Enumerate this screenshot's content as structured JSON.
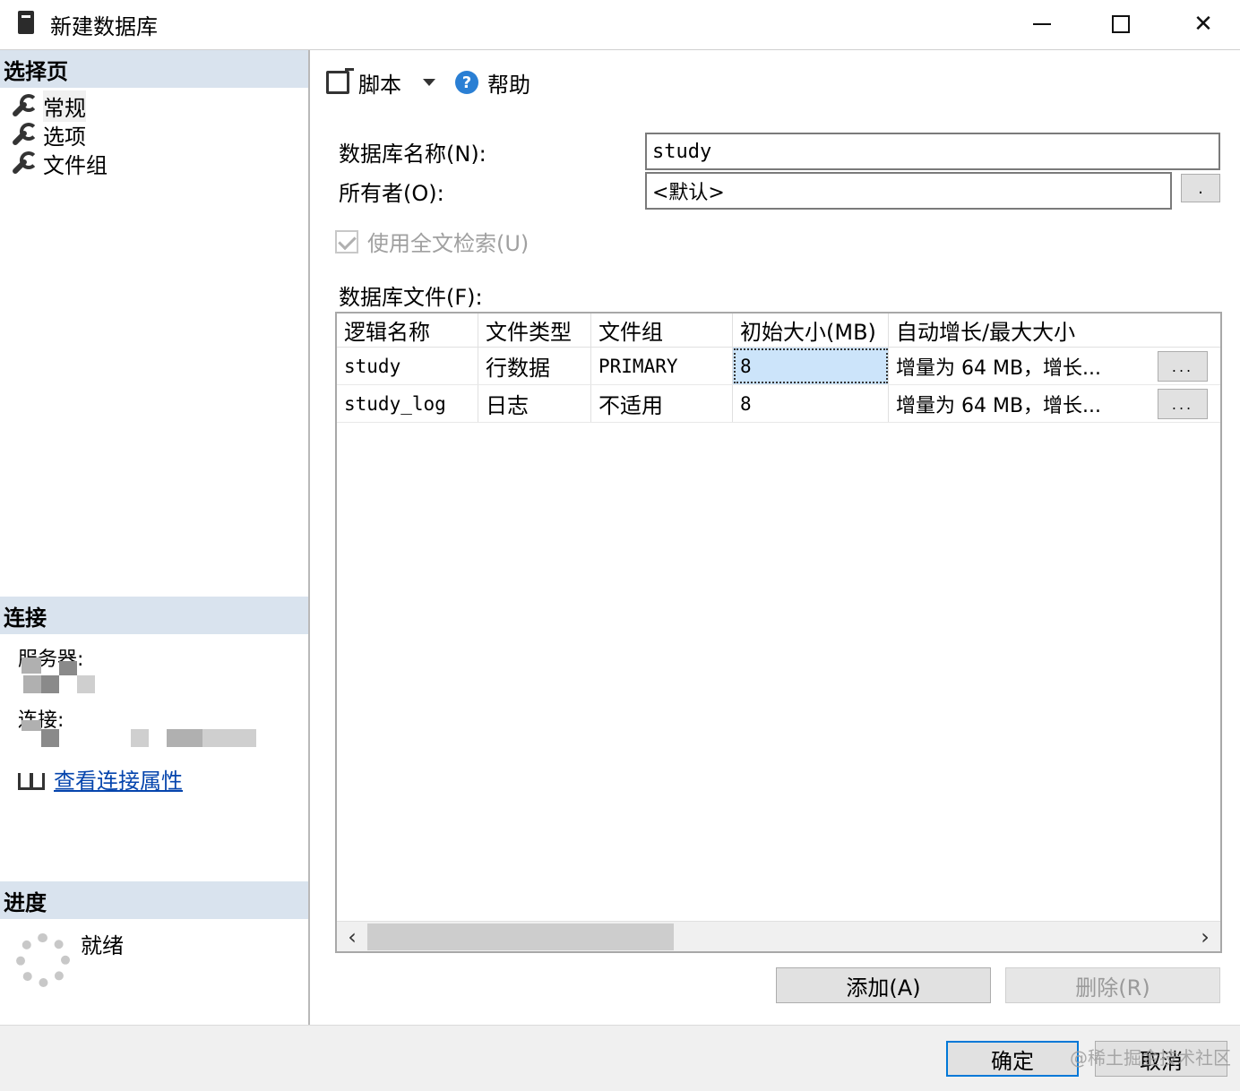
{
  "window": {
    "title": "新建数据库",
    "minimize": "─",
    "maximize": "☐",
    "close": "✕"
  },
  "left_panel": {
    "select_page_header": "选择页",
    "pages": [
      {
        "label": "常规",
        "selected": true
      },
      {
        "label": "选项",
        "selected": false
      },
      {
        "label": "文件组",
        "selected": false
      }
    ],
    "connection_header": "连接",
    "server_label": "服务器:",
    "connection_label": "连接:",
    "view_connection_link": "查看连接属性",
    "progress_header": "进度",
    "progress_status": "就绪"
  },
  "toolbar": {
    "script_label": "脚本",
    "help_label": "帮助"
  },
  "form": {
    "db_name_label": "数据库名称(N):",
    "db_name_value": "study",
    "owner_label": "所有者(O):",
    "owner_value": "<默认>",
    "owner_browse": ".",
    "fulltext_label": "使用全文检索(U)",
    "fulltext_checked": true,
    "files_label": "数据库文件(F):"
  },
  "files_table": {
    "columns": [
      "逻辑名称",
      "文件类型",
      "文件组",
      "初始大小(MB)",
      "自动增长/最大大小"
    ],
    "rows": [
      {
        "logical_name": "study",
        "file_type": "行数据",
        "filegroup": "PRIMARY",
        "initial_size": "8",
        "autogrowth": "增量为 64 MB，增长...",
        "button": "..."
      },
      {
        "logical_name": "study_log",
        "file_type": "日志",
        "filegroup": "不适用",
        "initial_size": "8",
        "autogrowth": "增量为 64 MB，增长...",
        "button": "..."
      }
    ]
  },
  "buttons": {
    "add": "添加(A)",
    "remove": "删除(R)",
    "ok": "确定",
    "cancel": "取消"
  },
  "watermark": "@稀土掘金技术社区",
  "colors": {
    "section_header_bg": "#d9e3ee",
    "selected_cell_bg": "#cce4fa",
    "link": "#0645ad",
    "help_icon": "#2a7fd4",
    "ok_border": "#0078d7"
  }
}
